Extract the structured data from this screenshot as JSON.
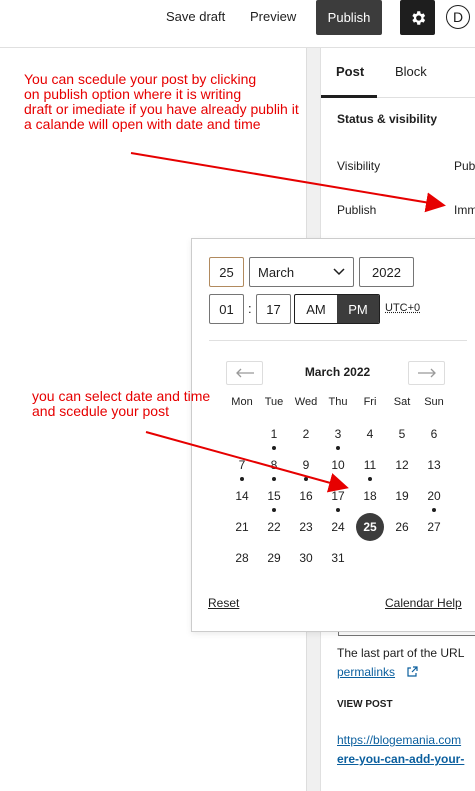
{
  "topbar": {
    "save_draft": "Save draft",
    "preview": "Preview",
    "publish": "Publish",
    "avatar_letter": "D"
  },
  "sidebar": {
    "tabs": [
      "Post",
      "Block"
    ],
    "section_title": "Status & visibility",
    "visibility_label": "Visibility",
    "visibility_value": "Pub",
    "publish_label": "Publish",
    "publish_value": "Imm",
    "url_text": "The last part of the URL",
    "permalinks": "permalinks",
    "view_post": "VIEW POST",
    "url_line1": "https://blogemania.com",
    "url_line2": "ere-you-can-add-your-"
  },
  "annotations": {
    "top_note": "You can scedule your post by clicking on publish option where it is writing draft or imediate if you have already publih it a calande will open with date and time",
    "top_lines": [
      "You can scedule your post by clicking",
      "on publish option where it is writing",
      "draft or imediate if you have already publih it",
      "a calande will open with date and time"
    ],
    "mid_lines": [
      "you can select date and time",
      "and scedule your post"
    ]
  },
  "datepicker": {
    "day": "25",
    "month": "March",
    "year": "2022",
    "hour": "01",
    "minute": "17",
    "am": "AM",
    "pm": "PM",
    "meridiem_selected": "PM",
    "timezone": "UTC+0",
    "calendar_title": "March 2022",
    "weekdays": [
      "Mon",
      "Tue",
      "Wed",
      "Thu",
      "Fri",
      "Sat",
      "Sun"
    ],
    "weeks": [
      [
        "",
        "1",
        "2",
        "3",
        "4",
        "5",
        "6"
      ],
      [
        "7",
        "8",
        "9",
        "10",
        "11",
        "12",
        "13"
      ],
      [
        "14",
        "15",
        "16",
        "17",
        "18",
        "19",
        "20"
      ],
      [
        "21",
        "22",
        "23",
        "24",
        "25",
        "26",
        "27"
      ],
      [
        "28",
        "29",
        "30",
        "31",
        "",
        "",
        ""
      ]
    ],
    "event_days": [
      "1",
      "3",
      "7",
      "8",
      "9",
      "11",
      "15",
      "17",
      "20"
    ],
    "selected_day": "25",
    "reset": "Reset",
    "help": "Calendar Help"
  },
  "colors": {
    "annotation": "#e60000",
    "primary_dark": "#3c3c3c",
    "link": "#0b5f9e"
  }
}
